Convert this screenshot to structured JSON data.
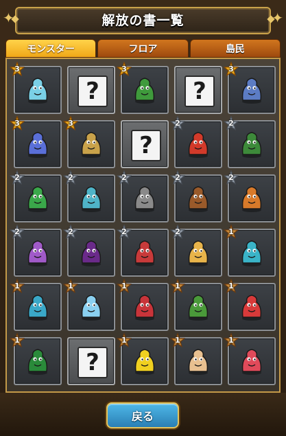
{
  "title": "解放の書一覧",
  "tabs": [
    {
      "label": "モンスター",
      "active": true
    },
    {
      "label": "フロア",
      "active": false
    },
    {
      "label": "島民",
      "active": false
    }
  ],
  "cells": [
    {
      "type": "monster",
      "stars": 3,
      "color": "#7ad0e6",
      "icon": "king-slime-icon"
    },
    {
      "type": "unknown",
      "label": "?"
    },
    {
      "type": "monster",
      "stars": 3,
      "color": "#3f9a3c",
      "icon": "green-orc-icon"
    },
    {
      "type": "unknown",
      "label": "?"
    },
    {
      "type": "monster",
      "stars": 3,
      "color": "#5c7cc4",
      "icon": "blue-wolf-icon"
    },
    {
      "type": "monster",
      "stars": 3,
      "color": "#5a6fd8",
      "icon": "blue-fairy-icon"
    },
    {
      "type": "monster",
      "stars": 3,
      "color": "#c9a24a",
      "icon": "golden-knight-icon"
    },
    {
      "type": "unknown",
      "label": "?"
    },
    {
      "type": "monster",
      "stars": 2,
      "color": "#d23a2a",
      "icon": "red-dragon-icon"
    },
    {
      "type": "monster",
      "stars": 2,
      "color": "#3d8a3a",
      "icon": "plant-monster-icon"
    },
    {
      "type": "monster",
      "stars": 2,
      "color": "#3aa84a",
      "icon": "carnivorous-plant-icon"
    },
    {
      "type": "monster",
      "stars": 2,
      "color": "#4fb4c8",
      "icon": "mermaid-icon"
    },
    {
      "type": "monster",
      "stars": 2,
      "color": "#8a8a8a",
      "icon": "harpy-icon"
    },
    {
      "type": "monster",
      "stars": 2,
      "color": "#9a5a2a",
      "icon": "minotaur-icon"
    },
    {
      "type": "monster",
      "stars": 2,
      "color": "#d87a2a",
      "icon": "puppet-icon"
    },
    {
      "type": "monster",
      "stars": 2,
      "color": "#a05ac8",
      "icon": "succubus-icon"
    },
    {
      "type": "monster",
      "stars": 2,
      "color": "#6a2a8a",
      "icon": "dark-knight-icon"
    },
    {
      "type": "monster",
      "stars": 2,
      "color": "#c83a3a",
      "icon": "vampire-girl-icon"
    },
    {
      "type": "monster",
      "stars": 2,
      "color": "#e8b44a",
      "icon": "butterfly-fairy-icon"
    },
    {
      "type": "monster",
      "stars": 1,
      "color": "#3ab4c8",
      "icon": "eye-creature-icon"
    },
    {
      "type": "monster",
      "stars": 1,
      "color": "#3aa8c8",
      "icon": "cyan-slime-icon"
    },
    {
      "type": "monster",
      "stars": 1,
      "color": "#8ad0f0",
      "icon": "ghost-slime-icon"
    },
    {
      "type": "monster",
      "stars": 1,
      "color": "#c8343a",
      "icon": "red-wyvern-icon"
    },
    {
      "type": "monster",
      "stars": 1,
      "color": "#4a9a3a",
      "icon": "green-golem-icon"
    },
    {
      "type": "monster",
      "stars": 1,
      "color": "#d83a3a",
      "icon": "red-imp-icon"
    },
    {
      "type": "monster",
      "stars": 1,
      "color": "#2a8a3a",
      "icon": "flytrap-icon"
    },
    {
      "type": "unknown",
      "label": "?"
    },
    {
      "type": "monster",
      "stars": 1,
      "color": "#f0d020",
      "icon": "sunflower-icon"
    },
    {
      "type": "monster",
      "stars": 1,
      "color": "#e8c090",
      "icon": "winged-bug-icon"
    },
    {
      "type": "monster",
      "stars": 1,
      "color": "#e04a5a",
      "icon": "red-haired-girl-icon"
    }
  ],
  "back_label": "戻る",
  "colors": {
    "accent_gold": "#c9a24a",
    "tab_active": "#f0a818",
    "tab_inactive": "#c86a1a",
    "back_button": "#2a8ac8"
  }
}
